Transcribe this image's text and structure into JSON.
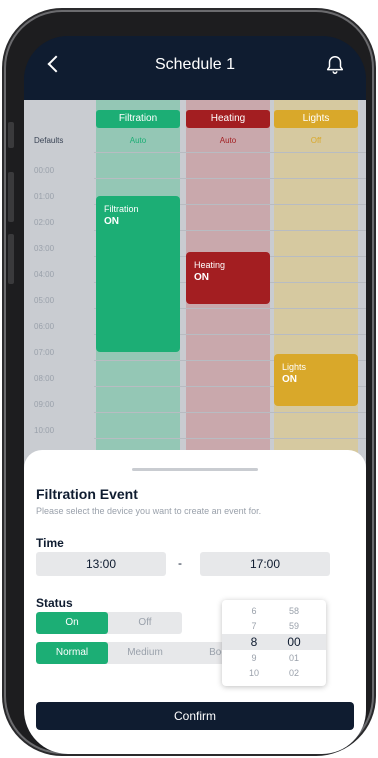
{
  "header": {
    "title": "Schedule 1",
    "back_icon": "chevron-left-icon",
    "bell_icon": "bell-icon"
  },
  "schedule": {
    "defaults_label": "Defaults",
    "times": [
      "00:00",
      "01:00",
      "02:00",
      "03:00",
      "04:00",
      "05:00",
      "06:00",
      "07:00",
      "08:00",
      "09:00",
      "10:00"
    ],
    "columns": [
      {
        "name": "Filtration",
        "default": "Auto",
        "color": "#1cae75"
      },
      {
        "name": "Heating",
        "default": "Auto",
        "color": "#a31e21"
      },
      {
        "name": "Lights",
        "default": "Off",
        "color": "#d9a82a"
      }
    ],
    "events": [
      {
        "name": "Filtration",
        "state": "ON",
        "column": "Filtration"
      },
      {
        "name": "Heating",
        "state": "ON",
        "column": "Heating"
      },
      {
        "name": "Lights",
        "state": "ON",
        "column": "Lights"
      }
    ]
  },
  "sheet": {
    "title": "Filtration Event",
    "subtitle": "Please select the device you want to create an event for.",
    "time_label": "Time",
    "start_time": "13:00",
    "separator": "-",
    "end_time": "17:00",
    "status_label": "Status",
    "status_options": [
      "On",
      "Off"
    ],
    "status_selected": "On",
    "mode_options": [
      "Normal",
      "Medium",
      "Boo"
    ],
    "mode_selected": "Normal",
    "picker": {
      "hours": [
        "6",
        "7",
        "8",
        "9",
        "10"
      ],
      "minutes": [
        "58",
        "59",
        "00",
        "01",
        "02"
      ],
      "selected_hour": "8",
      "selected_minute": "00"
    },
    "confirm_label": "Confirm"
  }
}
